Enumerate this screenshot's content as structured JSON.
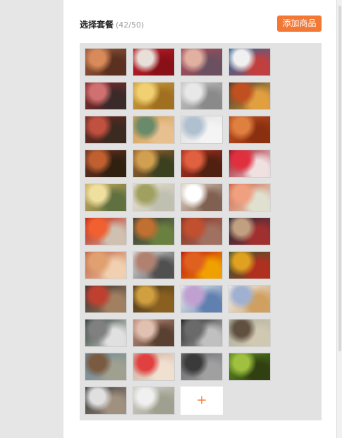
{
  "header": {
    "title": "选择套餐",
    "count": "(42/50)",
    "add_button": "添加商品"
  },
  "grid": {
    "add_tile_label": "+",
    "colors": [
      [
        "#9c5a3a",
        "#d88a5a",
        "#5a3020"
      ],
      [
        "#c0202a",
        "#e8e0d8",
        "#8a1018"
      ],
      [
        "#b04a5a",
        "#e0b0a0",
        "#6a5060"
      ],
      [
        "#2a6aa0",
        "#f0f0f0",
        "#c04040"
      ],
      [
        "#8a2a2a",
        "#d07070",
        "#3a2a2a"
      ],
      [
        "#d0a040",
        "#f0d070",
        "#a07020"
      ],
      [
        "#c8c8c8",
        "#e8e8e8",
        "#8a8a8a"
      ],
      [
        "#4a3a2a",
        "#c05020",
        "#e0a040"
      ],
      [
        "#6a2a20",
        "#c05040",
        "#3a2a20"
      ],
      [
        "#d0a050",
        "#6a8a6a",
        "#e8c090"
      ],
      [
        "#e0e0e0",
        "#b0c0d0",
        "#f4f4f4"
      ],
      [
        "#c05020",
        "#e08040",
        "#8a3010"
      ],
      [
        "#6a3020",
        "#c06030",
        "#302010"
      ],
      [
        "#a06030",
        "#d0a050",
        "#3a4020"
      ],
      [
        "#b03020",
        "#e06040",
        "#502010"
      ],
      [
        "#a01020",
        "#e03040",
        "#f0e0e0"
      ],
      [
        "#d0b060",
        "#f0e0a0",
        "#607040"
      ],
      [
        "#e8e0d0",
        "#a0a060",
        "#c0c0b0"
      ],
      [
        "#e0d0c0",
        "#ffffff",
        "#806050"
      ],
      [
        "#d06040",
        "#f0a080",
        "#e0e0d0"
      ],
      [
        "#c02010",
        "#f06030",
        "#d0c0b0"
      ],
      [
        "#3a3a3a",
        "#c07030",
        "#6a8040"
      ],
      [
        "#8a3020",
        "#c05030",
        "#a07060"
      ],
      [
        "#2a2a3a",
        "#c0a080",
        "#a03030"
      ],
      [
        "#c06040",
        "#e0a070",
        "#f0d0b0"
      ],
      [
        "#e0e0e0",
        "#b08070",
        "#505050"
      ],
      [
        "#c01010",
        "#e06020",
        "#f0a000"
      ],
      [
        "#3a5a2a",
        "#e0a020",
        "#b03020"
      ],
      [
        "#3a3030",
        "#c04030",
        "#a08060"
      ],
      [
        "#4a3a20",
        "#d0a040",
        "#8a6020"
      ],
      [
        "#f0f0f0",
        "#c0a0d0",
        "#6080b0"
      ],
      [
        "#f0f0f0",
        "#a0b0d0",
        "#d0a060"
      ],
      [
        "#2a3a30",
        "#808080",
        "#e0e0e0"
      ],
      [
        "#c09080",
        "#e0c0b0",
        "#5a4030"
      ],
      [
        "#202020",
        "#6a6a6a",
        "#c0c0c0"
      ],
      [
        "#b0b0a0",
        "#605040",
        "#d0c8b0"
      ],
      [
        "#6a8aa0",
        "#7a5a40",
        "#a0a090"
      ],
      [
        "#d0b0a0",
        "#e04040",
        "#f0e0d0"
      ],
      [
        "#6a6a70",
        "#3a3a3a",
        "#a0a0a0"
      ],
      [
        "#5a8a20",
        "#a0c040",
        "#304010"
      ],
      [
        "#3a3a3a",
        "#e0e0e0",
        "#a09080"
      ],
      [
        "#d0d0c8",
        "#f0f0f0",
        "#a0a090"
      ]
    ]
  }
}
